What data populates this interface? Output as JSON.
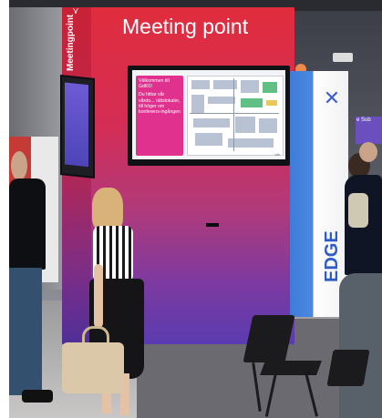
{
  "booth": {
    "headline": "Meeting point",
    "side_logo": "Meetingpoint"
  },
  "screen": {
    "panel_lines": [
      "Välkommen till Gdl01!",
      "Du hittar vår vårdo... rättslokaler, till höger om konferens-ingången"
    ],
    "footer": "Idé"
  },
  "right_booth": {
    "logo_glyph": "✕",
    "word": "EDGE",
    "back_screen_text": "e Sub"
  }
}
